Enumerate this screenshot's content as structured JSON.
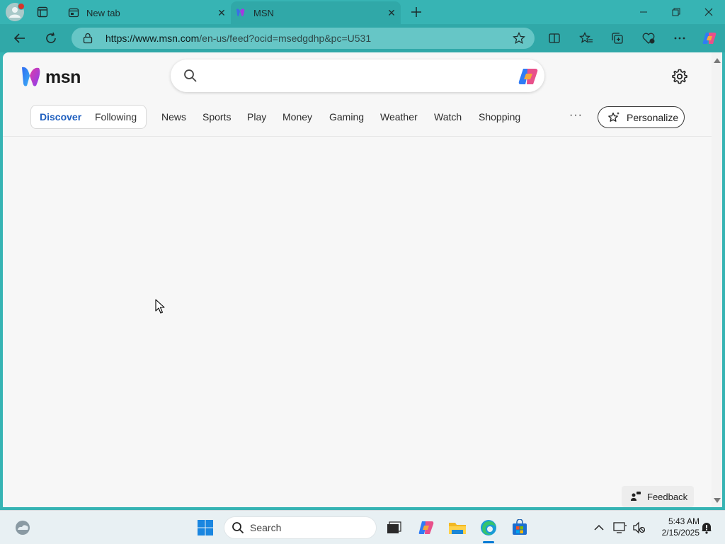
{
  "browser": {
    "tabs": [
      {
        "title": "New tab",
        "active": false
      },
      {
        "title": "MSN",
        "active": true
      }
    ],
    "address": {
      "url_host": "https://www.msn.com",
      "url_rest": "/en-us/feed?ocid=msedgdhp&pc=U531"
    },
    "window_controls": [
      "minimize",
      "restore",
      "close"
    ],
    "colors": {
      "accent": "#37b4b4",
      "toolbar": "#30a8a8",
      "address_bg": "#66c6c6"
    }
  },
  "page": {
    "logo_text": "msn",
    "search": {
      "placeholder": ""
    },
    "nav": {
      "primary": [
        {
          "label": "Discover",
          "selected": true
        },
        {
          "label": "Following",
          "selected": false
        }
      ],
      "items": [
        "News",
        "Sports",
        "Play",
        "Money",
        "Gaming",
        "Weather",
        "Watch",
        "Shopping"
      ],
      "more": "···",
      "personalize_label": "Personalize"
    },
    "feedback_label": "Feedback",
    "colors": {
      "background": "#f7f7f7",
      "selected_tab": "#1f5fbf"
    }
  },
  "taskbar": {
    "search_label": "Search",
    "time": "5:43 AM",
    "date": "2/15/2025",
    "pinned": [
      "start-icon",
      "task-view-icon",
      "copilot-icon",
      "file-explorer-icon",
      "edge-icon",
      "store-icon"
    ]
  }
}
